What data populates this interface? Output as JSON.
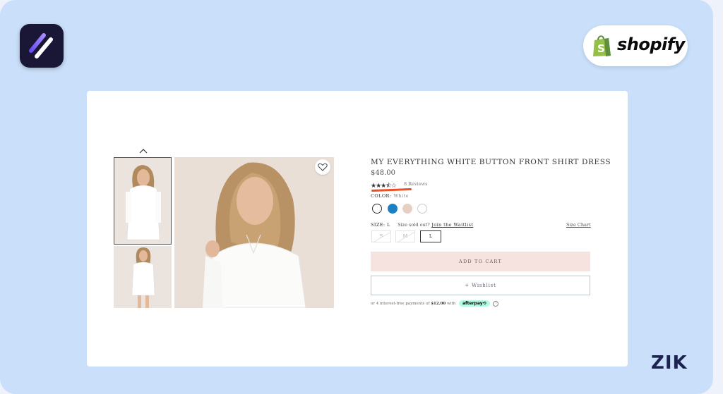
{
  "brand": {
    "shopify_label": "shopify",
    "watermark": "ZIK"
  },
  "product": {
    "title": "MY EVERYTHING WHITE BUTTON FRONT SHIRT DRESS",
    "price": "$48.00",
    "rating": 3.5,
    "rating_stars": "★★★⯪☆",
    "reviews": "8 Reviews",
    "color_label": "COLOR:",
    "color_value": "White",
    "swatches": [
      "#ffffff",
      "#1a82c4",
      "#e6cfc3",
      "#ffffff"
    ],
    "size_label": "SIZE:",
    "size_value": "L",
    "sold_out_text": "Size sold out?",
    "waitlist_link": "Join the Waitlist",
    "size_chart": "Size Chart",
    "sizes": [
      "S",
      "M",
      "L"
    ],
    "add_to_cart": "ADD TO CART",
    "wishlist": "+ Wishlist",
    "afterpay_prefix": "or 4 interest-free payments of",
    "afterpay_amount": "$12.00",
    "afterpay_with": "with",
    "afterpay_brand": "afterpay⟲"
  },
  "colors": {
    "frame_bg": "#c9dffa",
    "highlight_underline": "#e8522b",
    "add_to_cart_bg": "#f6e3e0"
  }
}
